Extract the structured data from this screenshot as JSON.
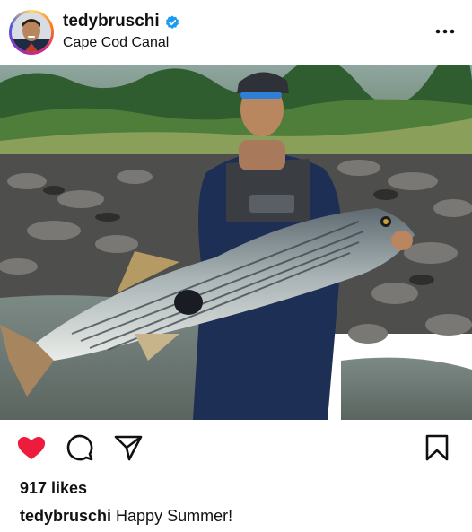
{
  "post": {
    "username": "tedybruschi",
    "location": "Cape Cod Canal",
    "likes": "917 likes",
    "caption_user": "tedybruschi",
    "caption_text": "Happy Summer!",
    "liked": true
  },
  "colors": {
    "like_red": "#ed1c3c",
    "verified_blue": "#1d9bf0"
  },
  "icons": {
    "header": [
      "verified-badge-icon",
      "more-options-icon"
    ],
    "actions": [
      "heart-icon",
      "comment-icon",
      "share-icon",
      "bookmark-icon"
    ]
  }
}
